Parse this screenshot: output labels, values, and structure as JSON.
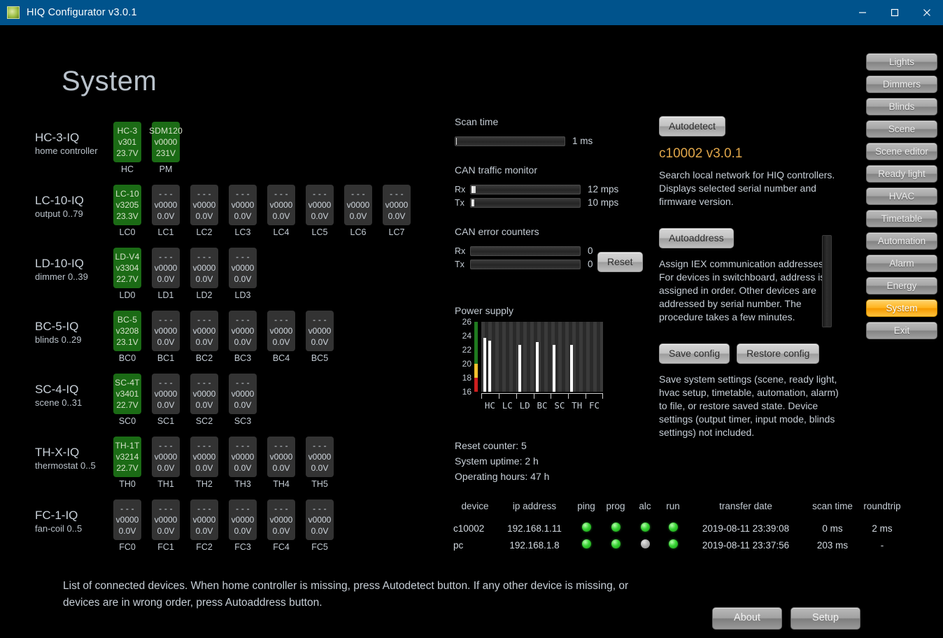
{
  "window": {
    "title": "HIQ Configurator v3.0.1",
    "logo_icon": "app-logo-icon",
    "minimize_label": "—",
    "maximize_label": "☐",
    "close_label": "✕"
  },
  "page": {
    "title": "System"
  },
  "device_matrix": {
    "rows": [
      {
        "name": "HC-3-IQ",
        "sub": "home controller",
        "tiles": [
          {
            "tag": "HC",
            "l1": "HC-3",
            "l2": "v301",
            "l3": "23.7V",
            "active": true
          },
          {
            "tag": "PM",
            "l1": "SDM120",
            "l2": "v0000",
            "l3": "231V",
            "active": true
          }
        ]
      },
      {
        "name": "LC-10-IQ",
        "sub": "output 0..79",
        "tiles": [
          {
            "tag": "LC0",
            "l1": "LC-10",
            "l2": "v3205",
            "l3": "23.3V",
            "active": true
          },
          {
            "tag": "LC1",
            "l1": "- - -",
            "l2": "v0000",
            "l3": "0.0V",
            "active": false
          },
          {
            "tag": "LC2",
            "l1": "- - -",
            "l2": "v0000",
            "l3": "0.0V",
            "active": false
          },
          {
            "tag": "LC3",
            "l1": "- - -",
            "l2": "v0000",
            "l3": "0.0V",
            "active": false
          },
          {
            "tag": "LC4",
            "l1": "- - -",
            "l2": "v0000",
            "l3": "0.0V",
            "active": false
          },
          {
            "tag": "LC5",
            "l1": "- - -",
            "l2": "v0000",
            "l3": "0.0V",
            "active": false
          },
          {
            "tag": "LC6",
            "l1": "- - -",
            "l2": "v0000",
            "l3": "0.0V",
            "active": false
          },
          {
            "tag": "LC7",
            "l1": "- - -",
            "l2": "v0000",
            "l3": "0.0V",
            "active": false
          }
        ]
      },
      {
        "name": "LD-10-IQ",
        "sub": "dimmer 0..39",
        "tiles": [
          {
            "tag": "LD0",
            "l1": "LD-V4",
            "l2": "v3304",
            "l3": "22.7V",
            "active": true
          },
          {
            "tag": "LD1",
            "l1": "- - -",
            "l2": "v0000",
            "l3": "0.0V",
            "active": false
          },
          {
            "tag": "LD2",
            "l1": "- - -",
            "l2": "v0000",
            "l3": "0.0V",
            "active": false
          },
          {
            "tag": "LD3",
            "l1": "- - -",
            "l2": "v0000",
            "l3": "0.0V",
            "active": false
          }
        ]
      },
      {
        "name": "BC-5-IQ",
        "sub": "blinds 0..29",
        "tiles": [
          {
            "tag": "BC0",
            "l1": "BC-5",
            "l2": "v3208",
            "l3": "23.1V",
            "active": true
          },
          {
            "tag": "BC1",
            "l1": "- - -",
            "l2": "v0000",
            "l3": "0.0V",
            "active": false
          },
          {
            "tag": "BC2",
            "l1": "- - -",
            "l2": "v0000",
            "l3": "0.0V",
            "active": false
          },
          {
            "tag": "BC3",
            "l1": "- - -",
            "l2": "v0000",
            "l3": "0.0V",
            "active": false
          },
          {
            "tag": "BC4",
            "l1": "- - -",
            "l2": "v0000",
            "l3": "0.0V",
            "active": false
          },
          {
            "tag": "BC5",
            "l1": "- - -",
            "l2": "v0000",
            "l3": "0.0V",
            "active": false
          }
        ]
      },
      {
        "name": "SC-4-IQ",
        "sub": "scene 0..31",
        "tiles": [
          {
            "tag": "SC0",
            "l1": "SC-4T",
            "l2": "v3401",
            "l3": "22.7V",
            "active": true
          },
          {
            "tag": "SC1",
            "l1": "- - -",
            "l2": "v0000",
            "l3": "0.0V",
            "active": false
          },
          {
            "tag": "SC2",
            "l1": "- - -",
            "l2": "v0000",
            "l3": "0.0V",
            "active": false
          },
          {
            "tag": "SC3",
            "l1": "- - -",
            "l2": "v0000",
            "l3": "0.0V",
            "active": false
          }
        ]
      },
      {
        "name": "TH-X-IQ",
        "sub": "thermostat 0..5",
        "tiles": [
          {
            "tag": "TH0",
            "l1": "TH-1T",
            "l2": "v3214",
            "l3": "22.7V",
            "active": true
          },
          {
            "tag": "TH1",
            "l1": "- - -",
            "l2": "v0000",
            "l3": "0.0V",
            "active": false
          },
          {
            "tag": "TH2",
            "l1": "- - -",
            "l2": "v0000",
            "l3": "0.0V",
            "active": false
          },
          {
            "tag": "TH3",
            "l1": "- - -",
            "l2": "v0000",
            "l3": "0.0V",
            "active": false
          },
          {
            "tag": "TH4",
            "l1": "- - -",
            "l2": "v0000",
            "l3": "0.0V",
            "active": false
          },
          {
            "tag": "TH5",
            "l1": "- - -",
            "l2": "v0000",
            "l3": "0.0V",
            "active": false
          }
        ]
      },
      {
        "name": "FC-1-IQ",
        "sub": "fan-coil 0..5",
        "tiles": [
          {
            "tag": "FC0",
            "l1": "- - -",
            "l2": "v0000",
            "l3": "0.0V",
            "active": false
          },
          {
            "tag": "FC1",
            "l1": "- - -",
            "l2": "v0000",
            "l3": "0.0V",
            "active": false
          },
          {
            "tag": "FC2",
            "l1": "- - -",
            "l2": "v0000",
            "l3": "0.0V",
            "active": false
          },
          {
            "tag": "FC3",
            "l1": "- - -",
            "l2": "v0000",
            "l3": "0.0V",
            "active": false
          },
          {
            "tag": "FC4",
            "l1": "- - -",
            "l2": "v0000",
            "l3": "0.0V",
            "active": false
          },
          {
            "tag": "FC5",
            "l1": "- - -",
            "l2": "v0000",
            "l3": "0.0V",
            "active": false
          }
        ]
      }
    ]
  },
  "monitors": {
    "scan_time": {
      "label": "Scan time",
      "value": "1 ms",
      "fill_pct": 2
    },
    "can_traffic": {
      "label": "CAN traffic monitor",
      "rx": {
        "tag": "Rx",
        "value": "12 mps",
        "fill_pct": 5
      },
      "tx": {
        "tag": "Tx",
        "value": "10 mps",
        "fill_pct": 4
      }
    },
    "can_errors": {
      "label": "CAN error counters",
      "rx": {
        "tag": "Rx",
        "value": "0",
        "fill_pct": 0
      },
      "tx": {
        "tag": "Tx",
        "value": "0",
        "fill_pct": 0
      },
      "reset_label": "Reset"
    }
  },
  "chart_data": {
    "type": "bar",
    "title": "Power supply",
    "xlabel": "",
    "ylabel": "",
    "ylim": [
      16,
      26
    ],
    "yticks": [
      16,
      18,
      20,
      22,
      24,
      26
    ],
    "grid": true,
    "categories": [
      "HC",
      "LC",
      "LD",
      "BC",
      "SC",
      "TH",
      "FC"
    ],
    "group_slots": 7,
    "slots_per_group": 4,
    "bars": [
      {
        "group": "HC",
        "slot": 0,
        "label": "HC",
        "value": 23.7
      },
      {
        "group": "HC",
        "slot": 1,
        "label": "PM",
        "value": 23.3
      },
      {
        "group": "LD",
        "slot": 0,
        "label": "LD0",
        "value": 22.7
      },
      {
        "group": "BC",
        "slot": 0,
        "label": "BC0",
        "value": 23.1
      },
      {
        "group": "SC",
        "slot": 0,
        "label": "SC0",
        "value": 22.7
      },
      {
        "group": "TH",
        "slot": 0,
        "label": "TH0",
        "value": 22.7
      }
    ],
    "zones": [
      {
        "from": 20,
        "to": 26,
        "color": "#1f7a1f"
      },
      {
        "from": 18,
        "to": 20,
        "color": "#f2c12e"
      },
      {
        "from": 16,
        "to": 18,
        "color": "#cc1f1f"
      }
    ]
  },
  "stats": {
    "reset_counter": "Reset counter: 5",
    "system_uptime": "System uptime: 2 h",
    "operating_hours": "Operating hours: 47 h"
  },
  "device_table": {
    "headers": [
      "device",
      "ip address",
      "ping",
      "prog",
      "alc",
      "run",
      "transfer date",
      "scan time",
      "roundtrip"
    ],
    "rows": [
      {
        "device": "c10002",
        "ip": "192.168.1.11",
        "ping": "on",
        "prog": "on",
        "alc": "on",
        "run": "on",
        "transfer_date": "2019-08-11 23:39:08",
        "scan_time": "0 ms",
        "roundtrip": "2 ms"
      },
      {
        "device": "pc",
        "ip": "192.168.1.8",
        "ping": "on",
        "prog": "on",
        "alc": "off",
        "run": "on",
        "transfer_date": "2019-08-11 23:37:56",
        "scan_time": "203 ms",
        "roundtrip": "-"
      }
    ]
  },
  "right_panel": {
    "autodetect_label": "Autodetect",
    "controller_id": "c10002 v3.0.1",
    "autodetect_text": "Search local network for HIQ controllers. Displays selected serial number and firmware version.",
    "autoaddress_label": "Autoaddress",
    "autoaddress_text": "Assign IEX communication addresses. For devices in switchboard, address is assigned in order. Other devices are addressed by serial number. The procedure takes a few minutes.",
    "save_config_label": "Save config",
    "restore_config_label": "Restore config",
    "config_text": "Save system settings (scene, ready light, hvac setup, timetable, automation, alarm) to file, or restore saved state. Device settings (output timer, input mode, blinds settings) not included."
  },
  "bottom": {
    "note": "List of connected devices. When home controller is missing, press Autodetect button. If any other device is missing, or devices are in wrong order, press Autoaddress button.",
    "about_label": "About",
    "setup_label": "Setup"
  },
  "nav": {
    "items": [
      {
        "label": "Lights",
        "selected": false
      },
      {
        "label": "Dimmers",
        "selected": false
      },
      {
        "label": "Blinds",
        "selected": false
      },
      {
        "label": "Scene",
        "selected": false
      },
      {
        "label": "Scene editor",
        "selected": false
      },
      {
        "label": "Ready light",
        "selected": false
      },
      {
        "label": "HVAC",
        "selected": false
      },
      {
        "label": "Timetable",
        "selected": false
      },
      {
        "label": "Automation",
        "selected": false
      },
      {
        "label": "Alarm",
        "selected": false
      },
      {
        "label": "Energy",
        "selected": false
      },
      {
        "label": "System",
        "selected": true
      },
      {
        "label": "Exit",
        "selected": false
      }
    ]
  },
  "colors": {
    "titlebar": "#00538c",
    "accent": "#ffb41f",
    "active_tile": "#1b6b15",
    "inactive_tile": "#333333",
    "led_on": "#37d334",
    "led_off": "#b2b2b2"
  }
}
